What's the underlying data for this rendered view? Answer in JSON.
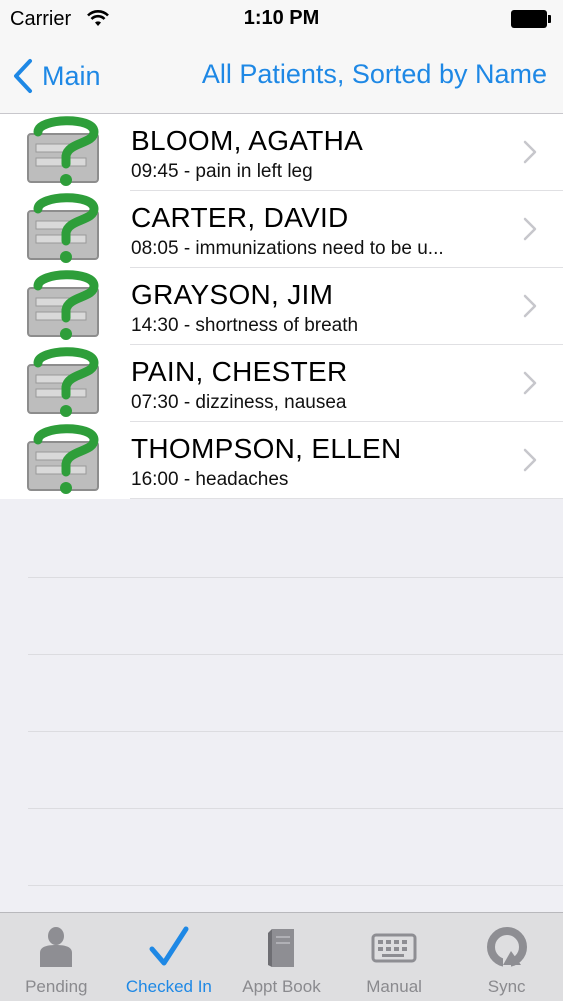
{
  "status": {
    "carrier": "Carrier",
    "time": "1:10 PM"
  },
  "nav": {
    "back_label": "Main",
    "title": "All Patients, Sorted by Name"
  },
  "patients": [
    {
      "name": "BLOOM, AGATHA",
      "detail": "09:45 - pain in left leg"
    },
    {
      "name": "CARTER, DAVID",
      "detail": "08:05 - immunizations need to be u..."
    },
    {
      "name": "GRAYSON, JIM",
      "detail": "14:30 - shortness of breath"
    },
    {
      "name": "PAIN, CHESTER",
      "detail": "07:30 - dizziness, nausea"
    },
    {
      "name": "THOMPSON, ELLEN",
      "detail": "16:00 - headaches"
    }
  ],
  "tabs": [
    {
      "label": "Pending",
      "icon": "person-icon"
    },
    {
      "label": "Checked In",
      "icon": "checkmark-icon",
      "active": true
    },
    {
      "label": "Appt Book",
      "icon": "book-icon"
    },
    {
      "label": "Manual",
      "icon": "keyboard-icon"
    },
    {
      "label": "Sync",
      "icon": "sync-icon"
    }
  ],
  "colors": {
    "accent": "#1e88e5",
    "icon_green": "#2e9e3a",
    "tab_inactive": "#8a8a8e"
  }
}
